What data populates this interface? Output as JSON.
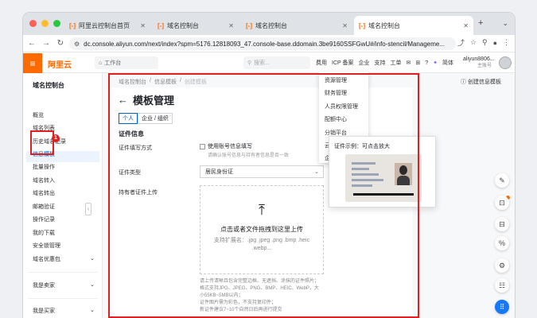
{
  "browser": {
    "tabs": [
      {
        "label": "阿里云控制台首页",
        "active": false
      },
      {
        "label": "域名控制台",
        "active": false
      },
      {
        "label": "域名控制台",
        "active": false
      },
      {
        "label": "域名控制台",
        "active": true
      }
    ],
    "url": "dc.console.aliyun.com/next/index?spm=5176.12818093_47.console-base.ddomain.3be9160SSFGwU#/info-stencil/Manageme..."
  },
  "header": {
    "logo": "阿里云",
    "workspace": "工作台",
    "search_placeholder": "搜索...",
    "menu": [
      "费用",
      "ICP 备案",
      "企业",
      "支持",
      "工单"
    ],
    "lang": "简体",
    "user_name": "aliyun8806...",
    "user_role": "主账号"
  },
  "sidebar": {
    "title": "域名控制台",
    "items": [
      "概览",
      "域名列表",
      "历史域名记录",
      "信息模板",
      "批量操作",
      "域名转入",
      "域名转出",
      "邮箱验证",
      "操作记录",
      "我的下载",
      "安全锁管理",
      "域名优惠包"
    ],
    "groups": [
      "我是卖家",
      "我是买家"
    ],
    "active_index": 3
  },
  "main": {
    "breadcrumb": [
      "域名控制台",
      "信息模板",
      "创建模板"
    ],
    "title": "模板管理",
    "create_link": "创建信息模板",
    "segment": [
      "个人",
      "企业 / 组织"
    ],
    "section": "证件信息",
    "label_fill": "证件填写方式",
    "checkbox_label": "使用账号信息填写",
    "checkbox_hint": "请确认账号信息与持有者信息是否一致",
    "label_cert_type": "证件类型",
    "cert_type_value": "居民身份证",
    "label_upload": "持有者证件上传",
    "upload_main": "点击或者文件拖拽到这里上传",
    "upload_sub": "支持扩展名：.jpg .jpeg .png .bmp .heic .webp...",
    "notes": [
      "请上传清晰且包含完整边框、无遮挡、涂抹的证件照片；",
      "格式支持JPG、JPEG、PNG、BMP、HEIC、WebP，大",
      "小55KB~5MB以内；",
      "证件图片需为彩色，不支持复印件；",
      "新证件建议7~10个自然日后再进行提交"
    ]
  },
  "dropdown": {
    "items": [
      "资源管理",
      "财务管理",
      "人员权限管理",
      "配额中心",
      "分销平台",
      "云",
      "企"
    ]
  },
  "popover": {
    "title": "证件示例：可点击放大"
  },
  "annotation": {
    "badge": "1"
  },
  "colors": {
    "brand": "#ff6a00",
    "annotation": "#e02020",
    "link": "#0064c8"
  }
}
